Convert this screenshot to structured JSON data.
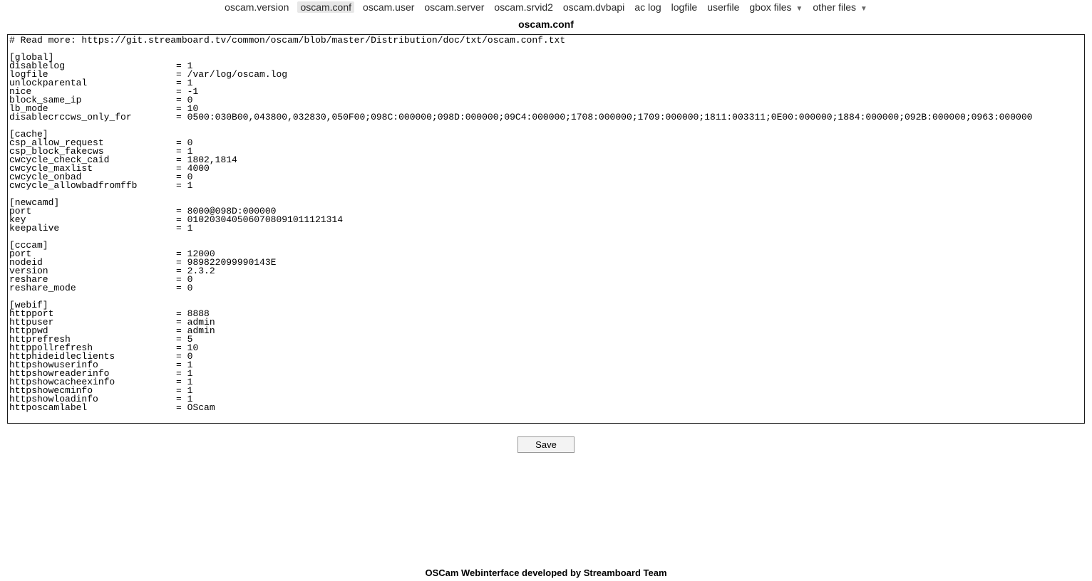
{
  "nav": {
    "items": [
      {
        "label": "oscam.version",
        "active": false
      },
      {
        "label": "oscam.conf",
        "active": true
      },
      {
        "label": "oscam.user",
        "active": false
      },
      {
        "label": "oscam.server",
        "active": false
      },
      {
        "label": "oscam.srvid2",
        "active": false
      },
      {
        "label": "oscam.dvbapi",
        "active": false
      },
      {
        "label": "ac log",
        "active": false
      },
      {
        "label": "logfile",
        "active": false
      },
      {
        "label": "userfile",
        "active": false
      },
      {
        "label": "gbox files",
        "active": false,
        "dropdown": true
      },
      {
        "label": "other files",
        "active": false,
        "dropdown": true
      }
    ]
  },
  "title": "oscam.conf",
  "editor": {
    "content": "# Read more: https://git.streamboard.tv/common/oscam/blob/master/Distribution/doc/txt/oscam.conf.txt\n\n[global]\ndisablelog                    = 1\nlogfile                       = /var/log/oscam.log\nunlockparental                = 1\nnice                          = -1\nblock_same_ip                 = 0\nlb_mode                       = 10\ndisablecrccws_only_for        = 0500:030B00,043800,032830,050F00;098C:000000;098D:000000;09C4:000000;1708:000000;1709:000000;1811:003311;0E00:000000;1884:000000;092B:000000;0963:000000\n\n[cache]\ncsp_allow_request             = 0\ncsp_block_fakecws             = 1\ncwcycle_check_caid            = 1802,1814\ncwcycle_maxlist               = 4000\ncwcycle_onbad                 = 0\ncwcycle_allowbadfromffb       = 1\n\n[newcamd]\nport                          = 8000@098D:000000\nkey                           = 0102030405060708091011121314\nkeepalive                     = 1\n\n[cccam]\nport                          = 12000\nnodeid                        = 989822099990143E\nversion                       = 2.3.2\nreshare                       = 0\nreshare_mode                  = 0\n\n[webif]\nhttpport                      = 8888\nhttpuser                      = admin\nhttppwd                       = admin\nhttprefresh                   = 5\nhttppollrefresh               = 10\nhttphideidleclients           = 0\nhttpshowuserinfo              = 1\nhttpshowreaderinfo            = 1\nhttpshowcacheexinfo           = 1\nhttpshowecminfo               = 1\nhttpshowloadinfo              = 1\nhttposcamlabel                = OScam"
  },
  "save_label": "Save",
  "footer": "OSCam Webinterface developed by Streamboard Team"
}
